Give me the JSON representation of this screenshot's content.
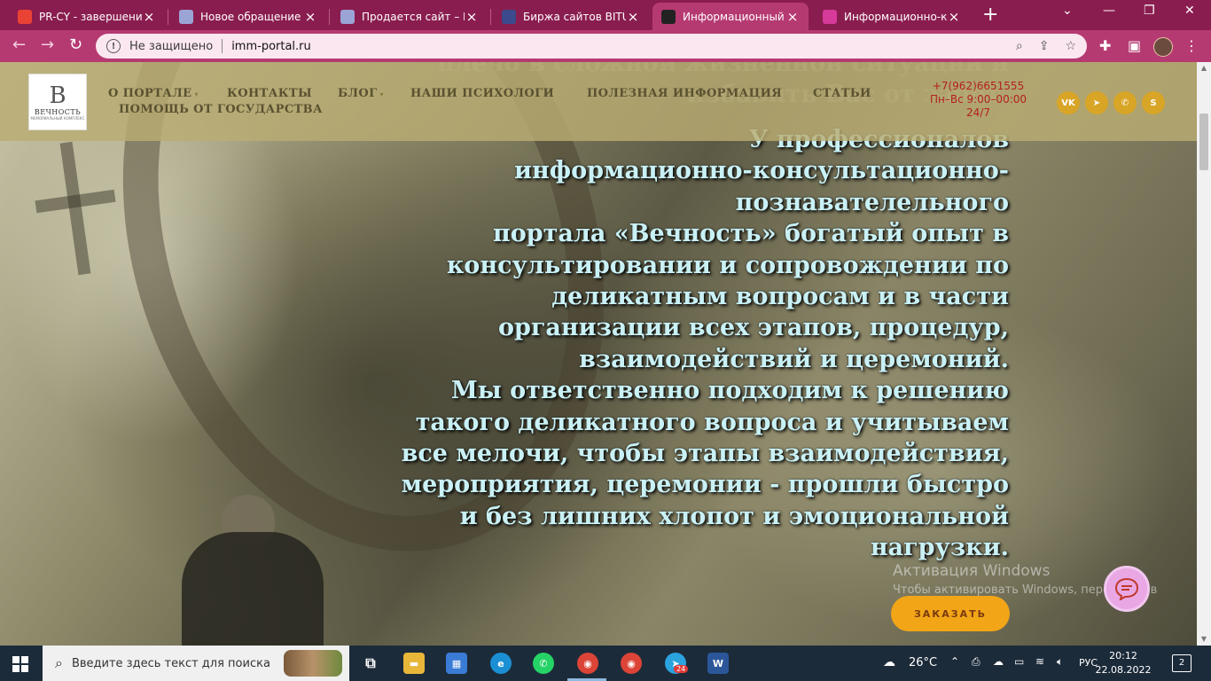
{
  "browser": {
    "tabs": [
      {
        "title": "PR-CY - завершение р",
        "favicon": "gmail-icon",
        "color": "#ea4335"
      },
      {
        "title": "Новое обращение",
        "favicon": "page-icon",
        "color": "#9aa5d6"
      },
      {
        "title": "Продается сайт – Инс",
        "favicon": "page-icon",
        "color": "#9aa5d6"
      },
      {
        "title": "Биржа сайтов BITUS -",
        "favicon": "bitus-icon",
        "color": "#3b4a8c"
      },
      {
        "title": "Информационный По",
        "favicon": "portal-icon",
        "color": "#222222",
        "active": true
      },
      {
        "title": "Информационно-кон",
        "favicon": "shield-icon",
        "color": "#d63a9a"
      }
    ],
    "security_label": "Не защищено",
    "url": "imm-portal.ru"
  },
  "site": {
    "logo": {
      "monogram": "B",
      "name": "ВЕЧНОСТЬ",
      "subtitle": "МЕМОРИАЛЬНЫЙ КОМПЛЕКС"
    },
    "menu": [
      {
        "label": "О ПОРТАЛЕ",
        "dropdown": true
      },
      {
        "label": "КОНТАКТЫ",
        "dropdown": false
      },
      {
        "label": "БЛОГ",
        "dropdown": true
      },
      {
        "label": "НАШИ ПСИХОЛОГИ",
        "dropdown": false
      },
      {
        "label": "ПОЛЕЗНАЯ ИНФОРМАЦИЯ",
        "dropdown": false
      },
      {
        "label": "СТАТЬИ",
        "dropdown": false
      },
      {
        "label": "ПОМОЩЬ ОТ ГОСУДАРСТВА",
        "dropdown": false
      }
    ],
    "contact": {
      "phone": "+7(962)6651555",
      "hours": "Пн–Вс 9:00–00:00",
      "always": "24/7"
    },
    "social": [
      {
        "name": "vk-icon",
        "glyph": "VK"
      },
      {
        "name": "telegram-icon",
        "glyph": "➤"
      },
      {
        "name": "whatsapp-icon",
        "glyph": "✆"
      },
      {
        "name": "skype-icon",
        "glyph": "S"
      }
    ],
    "hero_faded": [
      "плечо в сложной жизненной ситуации и",
      "избавить Вас от забот."
    ],
    "hero_lines": [
      "У профессионалов",
      "информационно-консультационно-",
      "познавателельного",
      "портала «Вечность» богатый опыт в",
      "консультировании и сопровождении по",
      "деликатным вопросам и в части",
      "организации всех этапов, процедур,",
      "взаимодействий и церемоний.",
      "Мы ответственно подходим к решению",
      "такого деликатного вопроса и учитываем",
      "все мелочи, чтобы этапы взаимодействия,",
      "мероприятия, церемонии - прошли быстро",
      "и без лишних хлопот и эмоциональной",
      "нагрузки."
    ],
    "order_button": "ЗАКАЗАТЬ",
    "accent_color": "#f2a617"
  },
  "watermark": {
    "line1": "Активация Windows",
    "line2": "Чтобы активировать Windows, перейдите в"
  },
  "taskbar": {
    "search_placeholder": "Введите здесь текст для поиска",
    "weather": "26°C",
    "language": "РУС",
    "time": "20:12",
    "date": "22.08.2022",
    "notifications": "2",
    "telegram_badge": "24"
  }
}
